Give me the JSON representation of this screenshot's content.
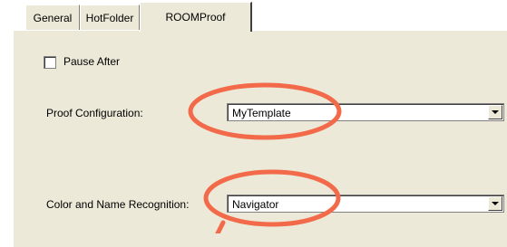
{
  "tabs": [
    {
      "label": "General"
    },
    {
      "label": "HotFolder"
    },
    {
      "label": "ROOMProof",
      "active": true
    }
  ],
  "pause_after": {
    "label": "Pause After",
    "checked": false
  },
  "proof_configuration": {
    "label": "Proof Configuration:",
    "value": "MyTemplate"
  },
  "color_name_recognition": {
    "label": "Color and Name Recognition:",
    "value": "Navigator"
  },
  "colors": {
    "annotation": "#f26a4a",
    "panel": "#ece9d8"
  }
}
